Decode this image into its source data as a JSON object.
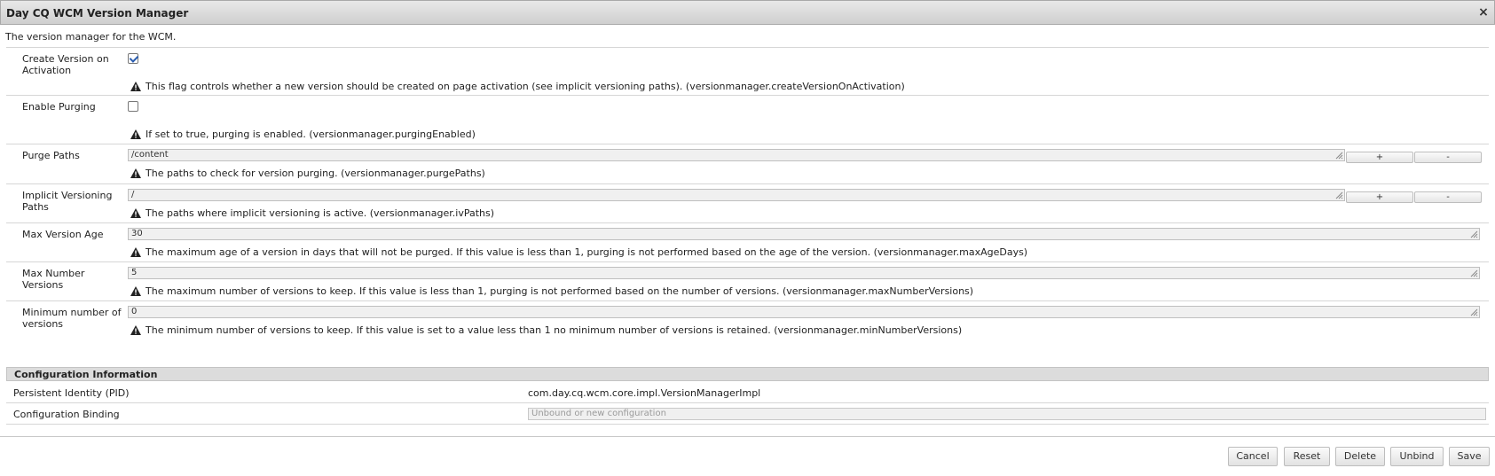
{
  "window": {
    "title": "Day CQ WCM Version Manager",
    "close_glyph": "×"
  },
  "description": "The version manager for the WCM.",
  "properties": {
    "create_version": {
      "label": "Create Version on Activation",
      "checked": true,
      "hint": "This flag controls whether a new version should be created on page activation (see implicit versioning paths). (versionmanager.createVersionOnActivation)"
    },
    "enable_purging": {
      "label": "Enable Purging",
      "checked": false,
      "hint": "If set to true, purging is enabled. (versionmanager.purgingEnabled)"
    },
    "purge_paths": {
      "label": "Purge Paths",
      "value": "/content",
      "add_label": "+",
      "remove_label": "-",
      "hint": "The paths to check for version purging. (versionmanager.purgePaths)"
    },
    "implicit_paths": {
      "label": "Implicit Versioning Paths",
      "value": "/",
      "add_label": "+",
      "remove_label": "-",
      "hint": "The paths where implicit versioning is active. (versionmanager.ivPaths)"
    },
    "max_age": {
      "label": "Max Version Age",
      "value": "30",
      "hint": "The maximum age of a version in days that will not be purged. If this value is less than 1, purging is not performed based on the age of the version. (versionmanager.maxAgeDays)"
    },
    "max_number": {
      "label": "Max Number Versions",
      "value": "5",
      "hint": "The maximum number of versions to keep. If this value is less than 1, purging is not performed based on the number of versions. (versionmanager.maxNumberVersions)"
    },
    "min_number": {
      "label": "Minimum number of versions",
      "value": "0",
      "hint": "The minimum number of versions to keep. If this value is set to a value less than 1 no minimum number of versions is retained. (versionmanager.minNumberVersions)"
    }
  },
  "config": {
    "header": "Configuration Information",
    "pid_label": "Persistent Identity (PID)",
    "pid_value": "com.day.cq.wcm.core.impl.VersionManagerImpl",
    "binding_label": "Configuration Binding",
    "binding_placeholder": "Unbound or new configuration"
  },
  "footer": {
    "cancel": "Cancel",
    "reset": "Reset",
    "delete": "Delete",
    "unbind": "Unbind",
    "save": "Save"
  }
}
